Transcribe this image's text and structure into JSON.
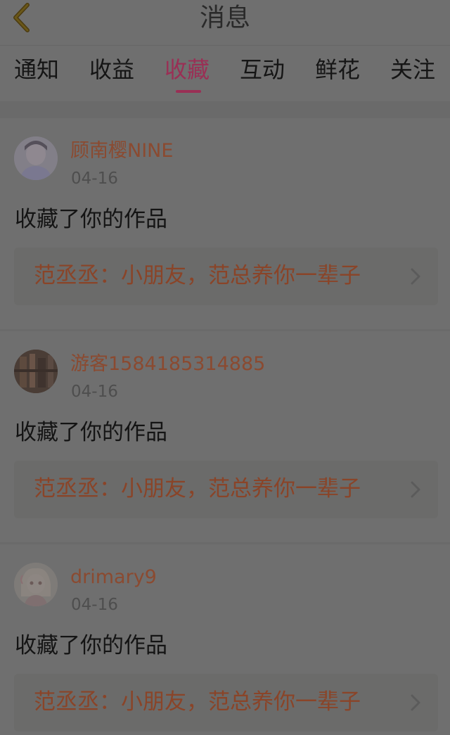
{
  "header": {
    "title": "消息"
  },
  "tabs": [
    {
      "label": "通知",
      "active": false
    },
    {
      "label": "收益",
      "active": false
    },
    {
      "label": "收藏",
      "active": true
    },
    {
      "label": "互动",
      "active": false
    },
    {
      "label": "鲜花",
      "active": false
    },
    {
      "label": "关注",
      "active": false
    }
  ],
  "messages": [
    {
      "username": "顾南樱NINE",
      "date": "04-16",
      "action": "收藏了你的作品",
      "work_title": "范丞丞：小朋友，范总养你一辈子"
    },
    {
      "username": "游客1584185314885",
      "date": "04-16",
      "action": "收藏了你的作品",
      "work_title": "范丞丞：小朋友，范总养你一辈子"
    },
    {
      "username": "drimary9",
      "date": "04-16",
      "action": "收藏了你的作品",
      "work_title": "范丞丞：小朋友，范总养你一辈子"
    }
  ],
  "colors": {
    "overlay_background": "#6f6f6f",
    "active_tab": "#9a2f55",
    "username": "#8b4a30",
    "work_title": "#8a4428"
  },
  "icons": {
    "back": "chevron-left-icon",
    "work_link": "chevron-right-icon"
  }
}
